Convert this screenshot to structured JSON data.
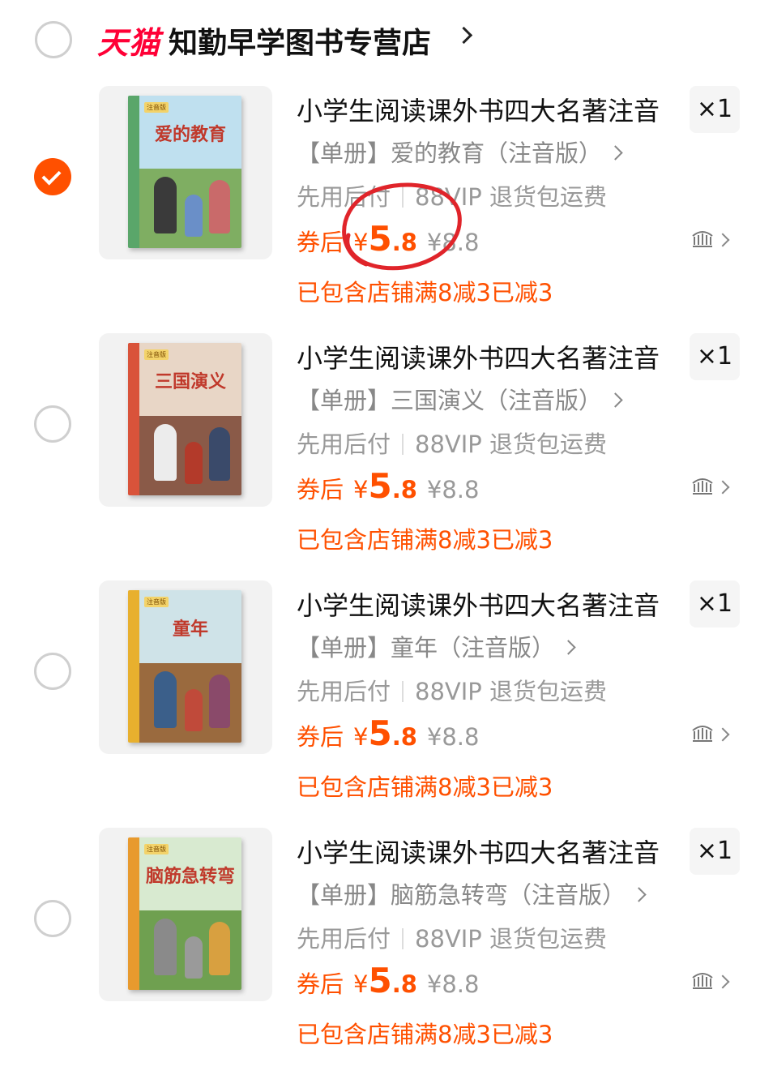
{
  "shop": {
    "platform_logo": "天猫",
    "name": "知勤早学图书专营店",
    "selected": false
  },
  "items": [
    {
      "selected": true,
      "title": "小学生阅读课外书四大名著注音",
      "quantity": "×1",
      "sku": "【单册】爱的教育（注音版）",
      "service_left": "先用后付",
      "service_right": "88VIP 退货包运费",
      "price_label": "券后",
      "price_yen": "¥",
      "price_int": "5",
      "price_dec": ".8",
      "original_price": "¥8.8",
      "promo": "已包含店铺满8减3已减3",
      "cover_title": "爱的教育",
      "cover_tag": "注音版",
      "cover_colors": {
        "spine": "#5aa66a",
        "sky": "#bfe0ef",
        "ground": "#7fae62",
        "f1": "#3a3a3a",
        "f2": "#6a8fc8",
        "f3": "#c96a6a"
      }
    },
    {
      "selected": false,
      "title": "小学生阅读课外书四大名著注音",
      "quantity": "×1",
      "sku": "【单册】三国演义（注音版）",
      "service_left": "先用后付",
      "service_right": "88VIP 退货包运费",
      "price_label": "券后",
      "price_yen": "¥",
      "price_int": "5",
      "price_dec": ".8",
      "original_price": "¥8.8",
      "promo": "已包含店铺满8减3已减3",
      "cover_title": "三国演义",
      "cover_tag": "注音版",
      "cover_colors": {
        "spine": "#d9533a",
        "sky": "#e8d6c6",
        "ground": "#8a5a48",
        "f1": "#ececec",
        "f2": "#b33a2a",
        "f3": "#3a4a6a"
      }
    },
    {
      "selected": false,
      "title": "小学生阅读课外书四大名著注音",
      "quantity": "×1",
      "sku": "【单册】童年（注音版）",
      "service_left": "先用后付",
      "service_right": "88VIP 退货包运费",
      "price_label": "券后",
      "price_yen": "¥",
      "price_int": "5",
      "price_dec": ".8",
      "original_price": "¥8.8",
      "promo": "已包含店铺满8减3已减3",
      "cover_title": "童年",
      "cover_tag": "注音版",
      "cover_colors": {
        "spine": "#e8b02e",
        "sky": "#cfe3e8",
        "ground": "#9a6a3e",
        "f1": "#3b5f8a",
        "f2": "#c04a3a",
        "f3": "#8a4a6a"
      }
    },
    {
      "selected": false,
      "title": "小学生阅读课外书四大名著注音",
      "quantity": "×1",
      "sku": "【单册】脑筋急转弯（注音版）",
      "service_left": "先用后付",
      "service_right": "88VIP 退货包运费",
      "price_label": "券后",
      "price_yen": "¥",
      "price_int": "5",
      "price_dec": ".8",
      "original_price": "¥8.8",
      "promo": "已包含店铺满8减3已减3",
      "cover_title": "脑筋急转弯",
      "cover_tag": "注音版",
      "cover_colors": {
        "spine": "#e89a2e",
        "sky": "#d8ead0",
        "ground": "#6fa050",
        "f1": "#8a8a8a",
        "f2": "#9a9a9a",
        "f3": "#d8a040"
      }
    }
  ],
  "annotation": {
    "color": "#e0242a"
  }
}
